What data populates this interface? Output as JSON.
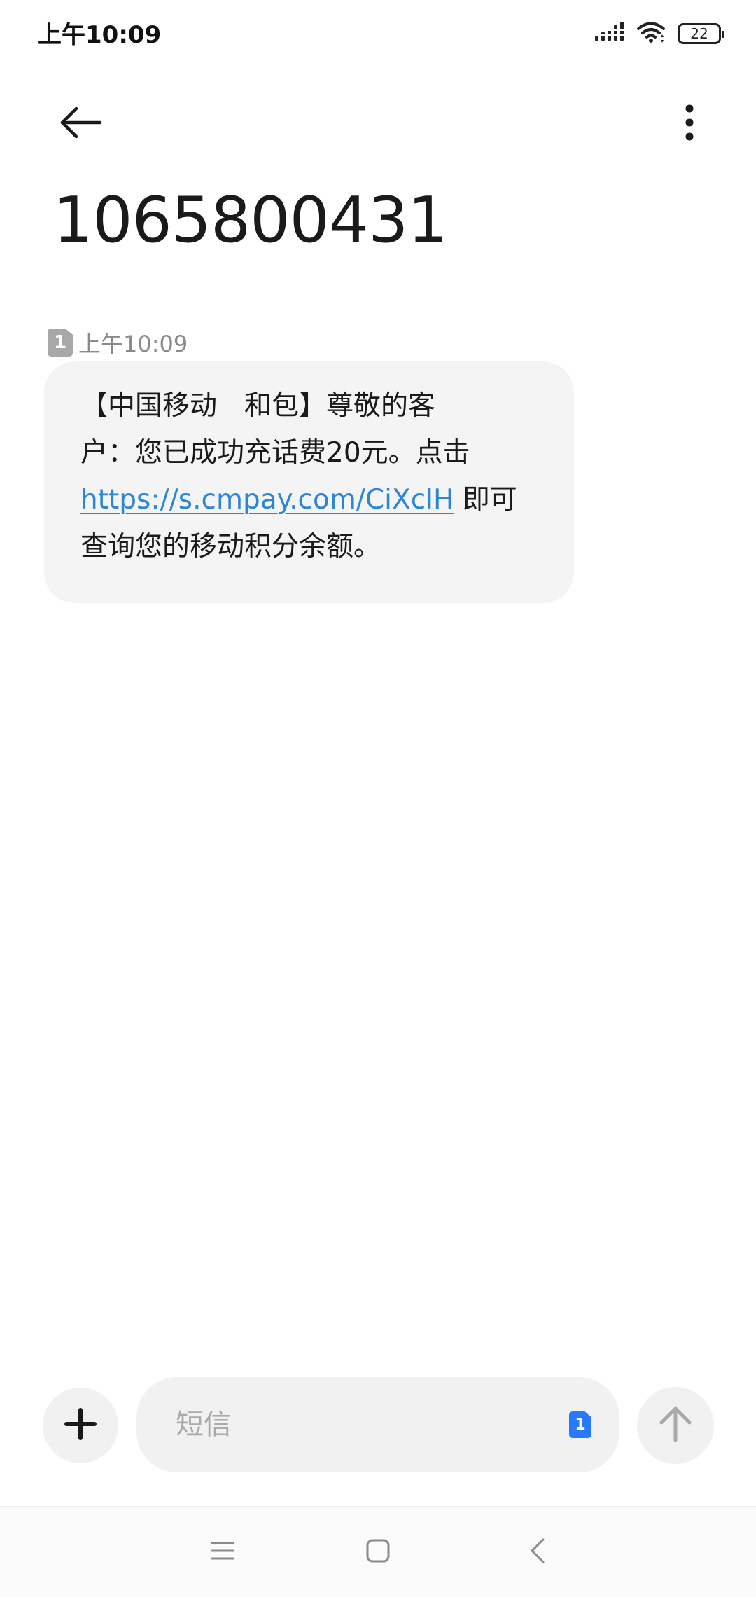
{
  "status_bar": {
    "time": "上午10:09",
    "battery_level": "22",
    "icons": [
      "signal-icon",
      "wifi-icon",
      "battery-icon"
    ]
  },
  "header": {
    "contact": "1065800431",
    "icons": [
      "back-arrow-icon",
      "more-vertical-icon"
    ]
  },
  "message": {
    "sim_slot": "1",
    "time": "上午10:09",
    "lines": [
      "【中国移动　和包】尊敬的客",
      "户：您已成功充话费20元。点击"
    ],
    "link_text": "https://s.cmpay.com/CiXclH",
    "after_link": " 即可",
    "last_line": "查询您的移动积分余额。"
  },
  "composer": {
    "placeholder": "短信",
    "value": "",
    "sim_slot": "1",
    "icons": [
      "plus-icon",
      "send-arrow-icon"
    ]
  },
  "nav_bar": {
    "icons": [
      "menu-icon",
      "home-icon",
      "back-icon"
    ]
  },
  "colors": {
    "bubble_bg": "#f4f4f4",
    "link": "#2c86d4",
    "sim_blue": "#2979ff",
    "composer_bg": "#f1f1f1"
  }
}
